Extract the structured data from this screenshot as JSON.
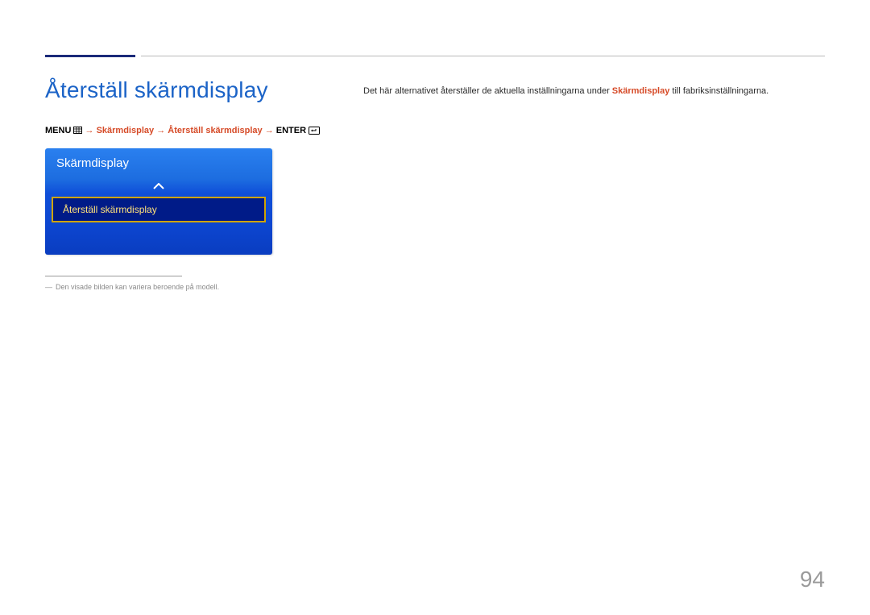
{
  "heading": "Återställ skärmdisplay",
  "breadcrumb": {
    "menu": "MENU",
    "p1": "Skärmdisplay",
    "p2": "Återställ skärmdisplay",
    "enter": "ENTER",
    "arrow": "→"
  },
  "osd": {
    "title": "Skärmdisplay",
    "selected": "Återställ skärmdisplay"
  },
  "footnote": {
    "dash": "―",
    "text": "Den visade bilden kan variera beroende på modell."
  },
  "right": {
    "pre": "Det här alternativet återställer de aktuella inställningarna under ",
    "em": "Skärmdisplay",
    "post": " till fabriksinställningarna."
  },
  "page": "94"
}
